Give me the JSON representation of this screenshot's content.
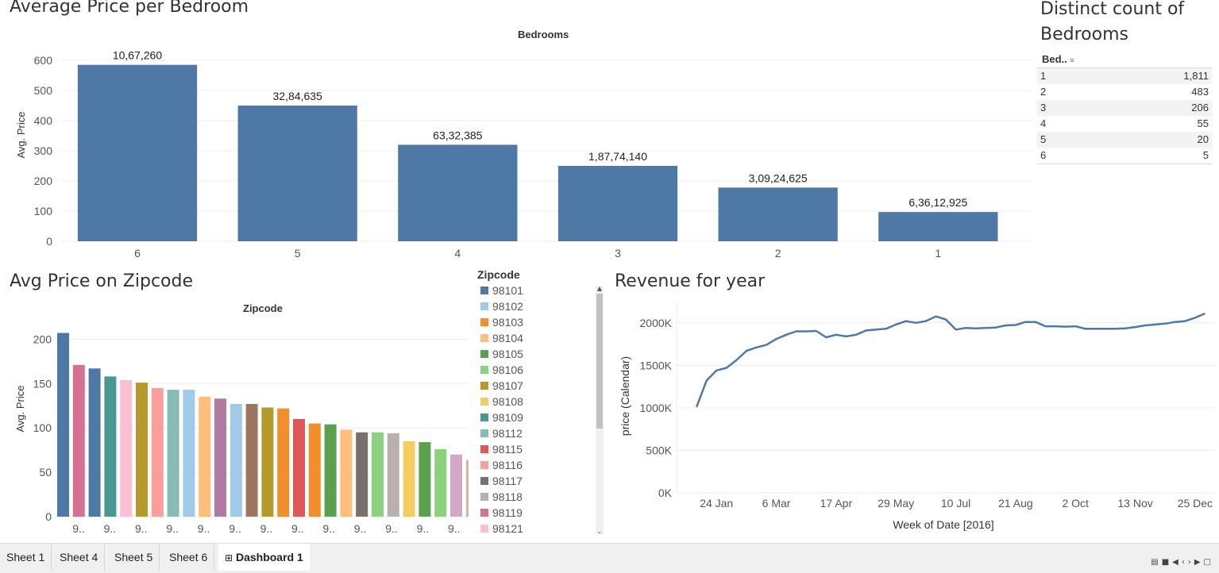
{
  "sheet1": {
    "title": "Average Price per Bedroom",
    "chart_data": {
      "type": "bar",
      "column_header": "Bedrooms",
      "categories": [
        "6",
        "5",
        "4",
        "3",
        "2",
        "1"
      ],
      "values": [
        585,
        450,
        320,
        250,
        178,
        97
      ],
      "data_labels": [
        "10,67,260",
        "32,84,635",
        "63,32,385",
        "1,87,74,140",
        "3,09,24,625",
        "6,36,12,925"
      ],
      "ylabel": "Avg. Price",
      "ylim": [
        0,
        600
      ],
      "yticks": [
        0,
        100,
        200,
        300,
        400,
        500,
        600
      ],
      "color": "#4e79a7",
      "grid": true
    }
  },
  "sheet2": {
    "title_lines": [
      "Distinct count of",
      "Bedrooms"
    ],
    "table": {
      "header": "Bed..",
      "rows": [
        {
          "label": "1",
          "value": "1,811"
        },
        {
          "label": "2",
          "value": "483"
        },
        {
          "label": "3",
          "value": "206"
        },
        {
          "label": "4",
          "value": "55"
        },
        {
          "label": "5",
          "value": "20"
        },
        {
          "label": "6",
          "value": "5"
        }
      ]
    }
  },
  "sheet3": {
    "title": "Avg Price on Zipcode",
    "chart_data": {
      "type": "bar",
      "column_header": "Zipcode",
      "ylabel": "Avg. Price",
      "ylim": [
        0,
        220
      ],
      "yticks": [
        0,
        50,
        100,
        150,
        200
      ],
      "grid": true,
      "tick_labels": [
        "9..",
        "9..",
        "9..",
        "9..",
        "9..",
        "9..",
        "9..",
        "9..",
        "9..",
        "9..",
        "9..",
        "9..",
        "9..",
        "9.."
      ],
      "values": [
        207,
        171,
        167,
        158,
        154,
        151,
        145,
        143,
        143,
        135,
        133,
        127,
        127,
        123,
        122,
        110,
        105,
        104,
        98,
        95,
        95,
        94,
        85,
        84,
        76,
        70,
        64
      ],
      "colors": [
        "#4e79a7",
        "#d37295",
        "#4e79a7",
        "#499894",
        "#fabfd2",
        "#b6992d",
        "#ff9d9a",
        "#86bcb6",
        "#a0cbe8",
        "#ffbe7d",
        "#b07aa1",
        "#a0cbe8",
        "#9d7660",
        "#b6992d",
        "#f28e2b",
        "#e15759",
        "#f28e2b",
        "#59a14f",
        "#ffbe7d",
        "#79706e",
        "#8cd17d",
        "#bab0ac",
        "#f1ce63",
        "#59a14f",
        "#8cd17d",
        "#d4a6c8",
        "#d7b5a6"
      ]
    },
    "legend": {
      "title": "Zipcode",
      "items": [
        {
          "label": "98101",
          "color": "#4e79a7"
        },
        {
          "label": "98102",
          "color": "#a0cbe8"
        },
        {
          "label": "98103",
          "color": "#f28e2b"
        },
        {
          "label": "98104",
          "color": "#ffbe7d"
        },
        {
          "label": "98105",
          "color": "#59a14f"
        },
        {
          "label": "98106",
          "color": "#8cd17d"
        },
        {
          "label": "98107",
          "color": "#b6992d"
        },
        {
          "label": "98108",
          "color": "#f1ce63"
        },
        {
          "label": "98109",
          "color": "#499894"
        },
        {
          "label": "98112",
          "color": "#86bcb6"
        },
        {
          "label": "98115",
          "color": "#e15759"
        },
        {
          "label": "98116",
          "color": "#ff9d9a"
        },
        {
          "label": "98117",
          "color": "#79706e"
        },
        {
          "label": "98118",
          "color": "#bab0ac"
        },
        {
          "label": "98119",
          "color": "#d37295"
        },
        {
          "label": "98121",
          "color": "#fabfd2"
        }
      ]
    }
  },
  "sheet4": {
    "title": "Revenue for year",
    "chart_data": {
      "type": "line",
      "xlabel": "Week of Date [2016]",
      "ylabel": "price (Calendar)",
      "xtick_labels": [
        "24 Jan",
        "6 Mar",
        "17 Apr",
        "29 May",
        "10 Jul",
        "21 Aug",
        "2 Oct",
        "13 Nov",
        "25 Dec"
      ],
      "xtick_weeks": [
        3,
        9,
        15,
        21,
        27,
        33,
        39,
        45,
        51
      ],
      "ytick_labels": [
        "0K",
        "500K",
        "1000K",
        "1500K",
        "2000K"
      ],
      "yticks": [
        0,
        500000,
        1000000,
        1500000,
        2000000
      ],
      "ylim": [
        0,
        2250000
      ],
      "xlim": [
        -1,
        53
      ],
      "week": [
        1,
        2,
        3,
        4,
        5,
        6,
        7,
        8,
        9,
        10,
        11,
        12,
        13,
        14,
        15,
        16,
        17,
        18,
        19,
        20,
        21,
        22,
        23,
        24,
        25,
        26,
        27,
        28,
        29,
        30,
        31,
        32,
        33,
        34,
        35,
        36,
        37,
        38,
        39,
        40,
        41,
        42,
        43,
        44,
        45,
        46,
        47,
        48,
        49,
        50,
        51,
        52
      ],
      "values": [
        1010000,
        1320000,
        1440000,
        1470000,
        1560000,
        1670000,
        1710000,
        1740000,
        1810000,
        1860000,
        1900000,
        1900000,
        1905000,
        1830000,
        1860000,
        1840000,
        1860000,
        1910000,
        1920000,
        1930000,
        1980000,
        2020000,
        2000000,
        2020000,
        2075000,
        2040000,
        1920000,
        1940000,
        1935000,
        1940000,
        1945000,
        1970000,
        1975000,
        2010000,
        2010000,
        1960000,
        1960000,
        1955000,
        1960000,
        1930000,
        1930000,
        1930000,
        1930000,
        1935000,
        1950000,
        1970000,
        1980000,
        1990000,
        2010000,
        2020000,
        2060000,
        2110000
      ],
      "color": "#4e79a7",
      "grid": true
    }
  },
  "tabs": [
    {
      "label": "Sheet 1"
    },
    {
      "label": "Sheet 4"
    },
    {
      "label": "Sheet 5"
    },
    {
      "label": "Sheet 6"
    },
    {
      "label": "Dashboard 1",
      "icon": "⊞",
      "active": true
    }
  ],
  "colors": {
    "gridline": "#ececec",
    "axis_text": "#555555"
  }
}
